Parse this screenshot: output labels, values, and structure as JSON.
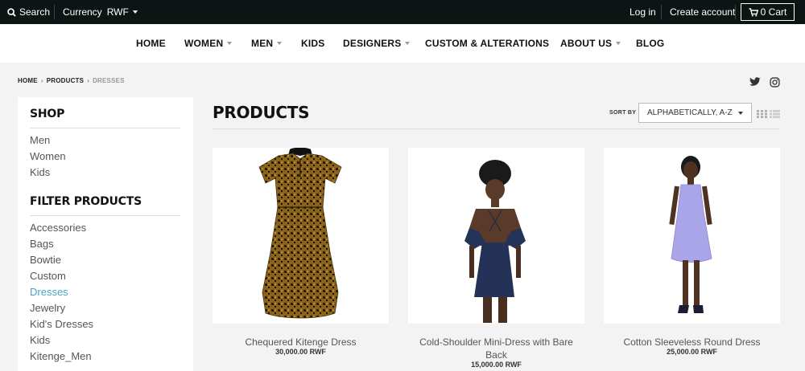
{
  "topbar": {
    "search_label": "Search",
    "currency_label": "Currency",
    "currency_value": "RWF",
    "login_label": "Log in",
    "create_account_label": "Create account",
    "cart_label": "0 Cart"
  },
  "nav": [
    {
      "label": "HOME",
      "has_dropdown": false
    },
    {
      "label": "WOMEN",
      "has_dropdown": true
    },
    {
      "label": "MEN",
      "has_dropdown": true
    },
    {
      "label": "KIDS",
      "has_dropdown": false
    },
    {
      "label": "DESIGNERS",
      "has_dropdown": true
    },
    {
      "label": "CUSTOM & ALTERATIONS",
      "has_dropdown": false
    },
    {
      "label": "ABOUT US",
      "has_dropdown": true
    },
    {
      "label": "BLOG",
      "has_dropdown": false
    }
  ],
  "breadcrumb": {
    "home": "HOME",
    "products": "PRODUCTS",
    "current": "DRESSES",
    "separator": "›"
  },
  "social": {
    "icons": [
      "twitter-icon",
      "instagram-icon"
    ]
  },
  "sidebar": {
    "shop_heading": "SHOP",
    "shop_links": [
      "Men",
      "Women",
      "Kids"
    ],
    "filter_heading": "FILTER PRODUCTS",
    "filter_links": [
      "Accessories",
      "Bags",
      "Bowtie",
      "Custom",
      "Dresses",
      "Jewelry",
      "Kid's Dresses",
      "Kids",
      "Kitenge_Men"
    ],
    "active_filter": "Dresses"
  },
  "main": {
    "title": "PRODUCTS",
    "sort_label": "SORT BY",
    "sort_value": "ALPHABETICALLY, A-Z"
  },
  "products": [
    {
      "name": "Chequered Kitenge Dress",
      "price": "30,000.00 RWF"
    },
    {
      "name": "Cold-Shoulder Mini-Dress with Bare Back",
      "price": "15,000.00 RWF"
    },
    {
      "name": "Cotton Sleeveless Round Dress",
      "price": "25,000.00 RWF"
    }
  ],
  "colors": {
    "topbar_bg": "#0c1414",
    "active_link": "#4aa3c3",
    "page_bg": "#f3f3f3"
  }
}
